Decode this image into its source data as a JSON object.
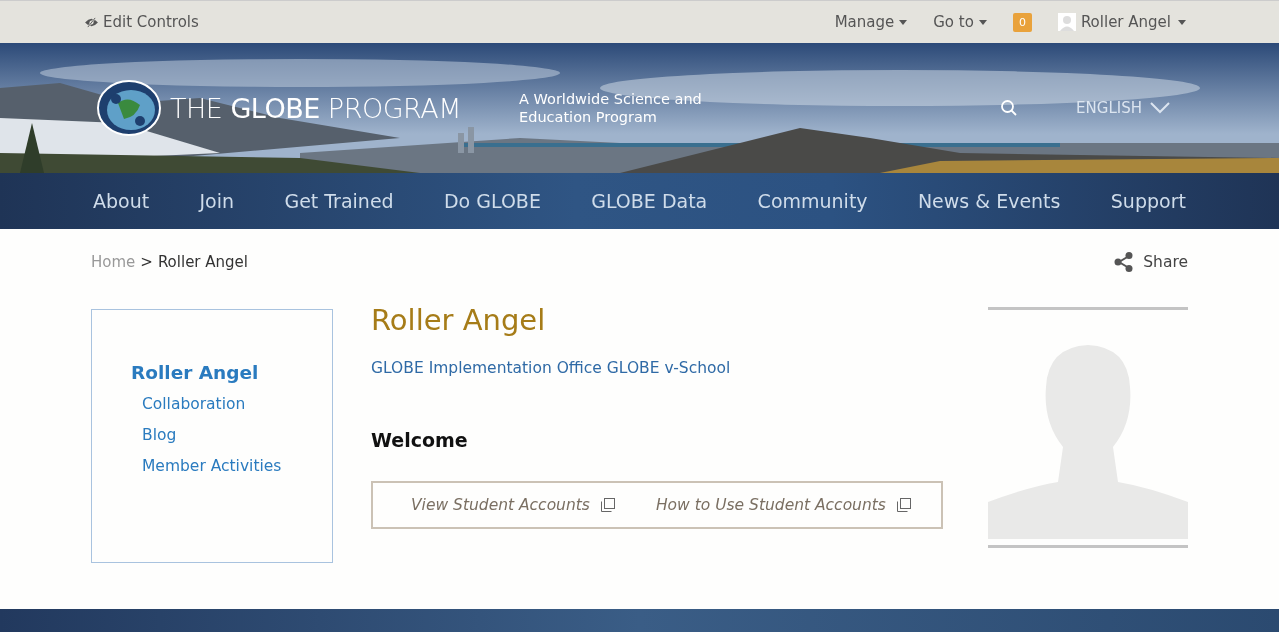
{
  "top_bar": {
    "edit_controls": "Edit Controls",
    "menus": [
      {
        "label": "Manage"
      },
      {
        "label": "Go to"
      }
    ],
    "notifications": "0",
    "user": "Roller Angel"
  },
  "banner": {
    "logo_text": "THE **GLOBE** PROGRAM",
    "tagline": "A Worldwide Science and Education Program",
    "language": "ENGLISH"
  },
  "nav": [
    {
      "label": "About"
    },
    {
      "label": "Join"
    },
    {
      "label": "Get Trained"
    },
    {
      "label": "Do GLOBE"
    },
    {
      "label": "GLOBE Data"
    },
    {
      "label": "Community"
    },
    {
      "label": "News & Events"
    },
    {
      "label": "Support"
    }
  ],
  "breadcrumb": {
    "home": "Home",
    "separator": ">",
    "current": "Roller Angel"
  },
  "share": "Share",
  "sidebar": {
    "items": [
      {
        "label": "Roller Angel",
        "selected": true
      },
      {
        "label": "Collaboration",
        "selected": false
      },
      {
        "label": "Blog",
        "selected": false
      },
      {
        "label": "Member Activities",
        "selected": false
      }
    ]
  },
  "profile": {
    "name": "Roller Angel",
    "affiliation": "GLOBE Implementation Office GLOBE v-School",
    "welcome": "Welcome",
    "links": [
      "View Student Accounts",
      "How to Use Student Accounts"
    ]
  }
}
